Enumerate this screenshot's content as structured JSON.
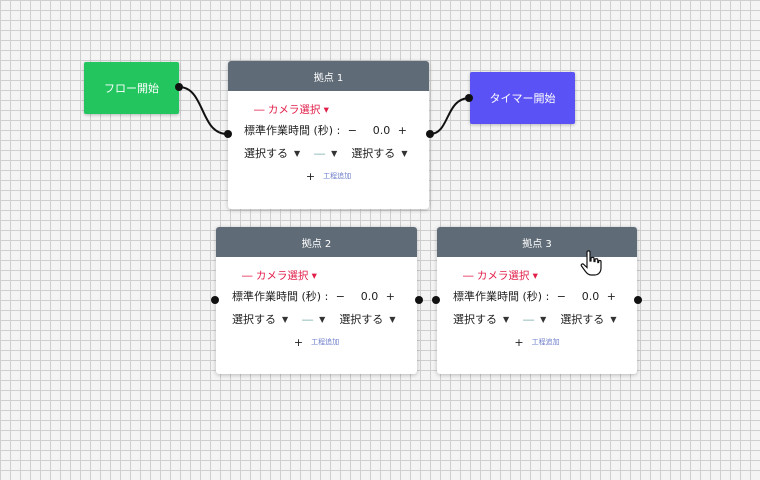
{
  "nodes": {
    "start": {
      "label": "フロー開始",
      "color": "#22c55e"
    },
    "timer": {
      "label": "タイマー開始",
      "color": "#5b52f5"
    }
  },
  "cards": [
    {
      "title": "拠点 1",
      "camera": "― カメラ選択 ▾",
      "work_label": "標準作業時間 (秒) :",
      "minus": "−",
      "value": "0.0",
      "plus": "+",
      "select_left": "選択する",
      "select_mid": "―",
      "select_right": "選択する",
      "add_label": "工程追加"
    },
    {
      "title": "拠点 2",
      "camera": "― カメラ選択 ▾",
      "work_label": "標準作業時間 (秒) :",
      "minus": "−",
      "value": "0.0",
      "plus": "+",
      "select_left": "選択する",
      "select_mid": "―",
      "select_right": "選択する",
      "add_label": "工程追加"
    },
    {
      "title": "拠点 3",
      "camera": "― カメラ選択 ▾",
      "work_label": "標準作業時間 (秒) :",
      "minus": "−",
      "value": "0.0",
      "plus": "+",
      "select_left": "選択する",
      "select_mid": "―",
      "select_right": "選択する",
      "add_label": "工程追加"
    }
  ],
  "colors": {
    "header": "#5f6b76",
    "camera": "#e11d48",
    "grid": "#cfcfcf"
  }
}
